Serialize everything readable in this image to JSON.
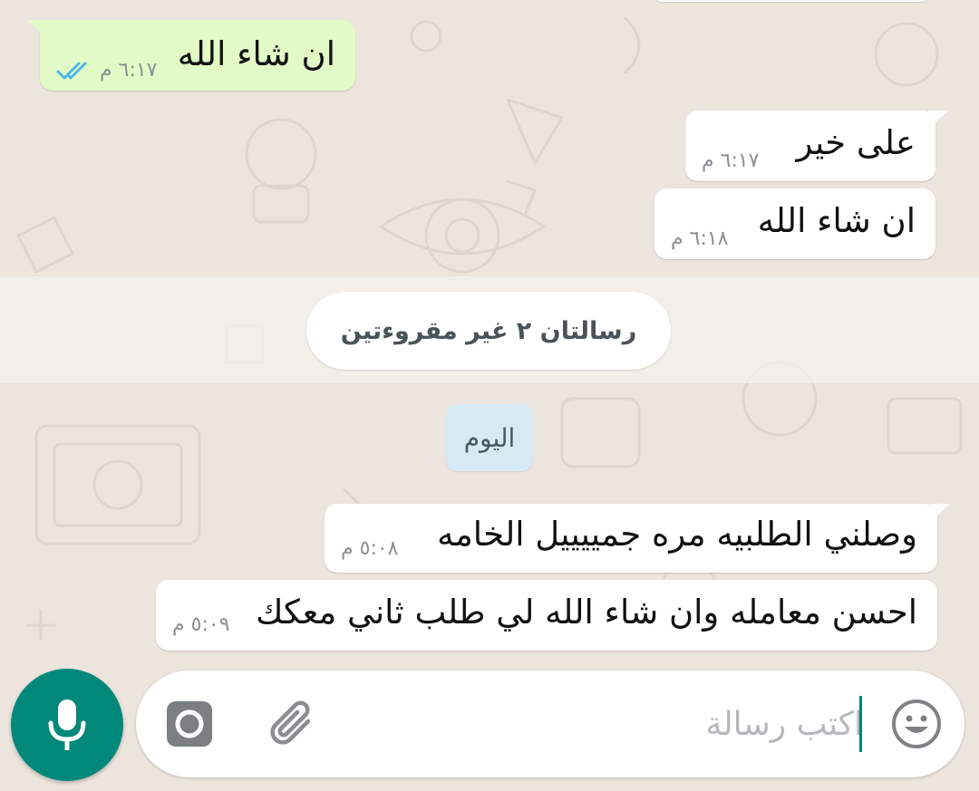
{
  "chat": {
    "messages": [
      {
        "dir": "out",
        "text": "ان شاء الله",
        "time": "٦:١٧ م",
        "status": "read-double-check-icon"
      },
      {
        "dir": "in",
        "text": "على خير",
        "time": "٦:١٧ م"
      },
      {
        "dir": "in",
        "text": "ان شاء الله",
        "time": "٦:١٨ م"
      },
      {
        "dir": "in",
        "text": "وصلني الطلبيه مره جمييييل الخامه",
        "time": "٥:٠٨ م"
      },
      {
        "dir": "in",
        "text": "احسن معامله وان شاء الله لي طلب ثاني معكك",
        "time": "٥:٠٩ م"
      }
    ],
    "unread_label": "رسالتان ٢ غير مقروءتين",
    "date_label": "اليوم"
  },
  "composer": {
    "placeholder": "اكتب رسالة",
    "value": "",
    "icons": {
      "emoji": "emoji-icon",
      "attach": "paperclip-icon",
      "camera": "camera-icon",
      "mic": "microphone-icon"
    }
  },
  "colors": {
    "background": "#ece5dd",
    "outgoing_bubble": "#e2fbc6",
    "incoming_bubble": "#ffffff",
    "accent": "#00897b",
    "read_check": "#4fb6ec",
    "date_chip": "#d6eaf5"
  }
}
